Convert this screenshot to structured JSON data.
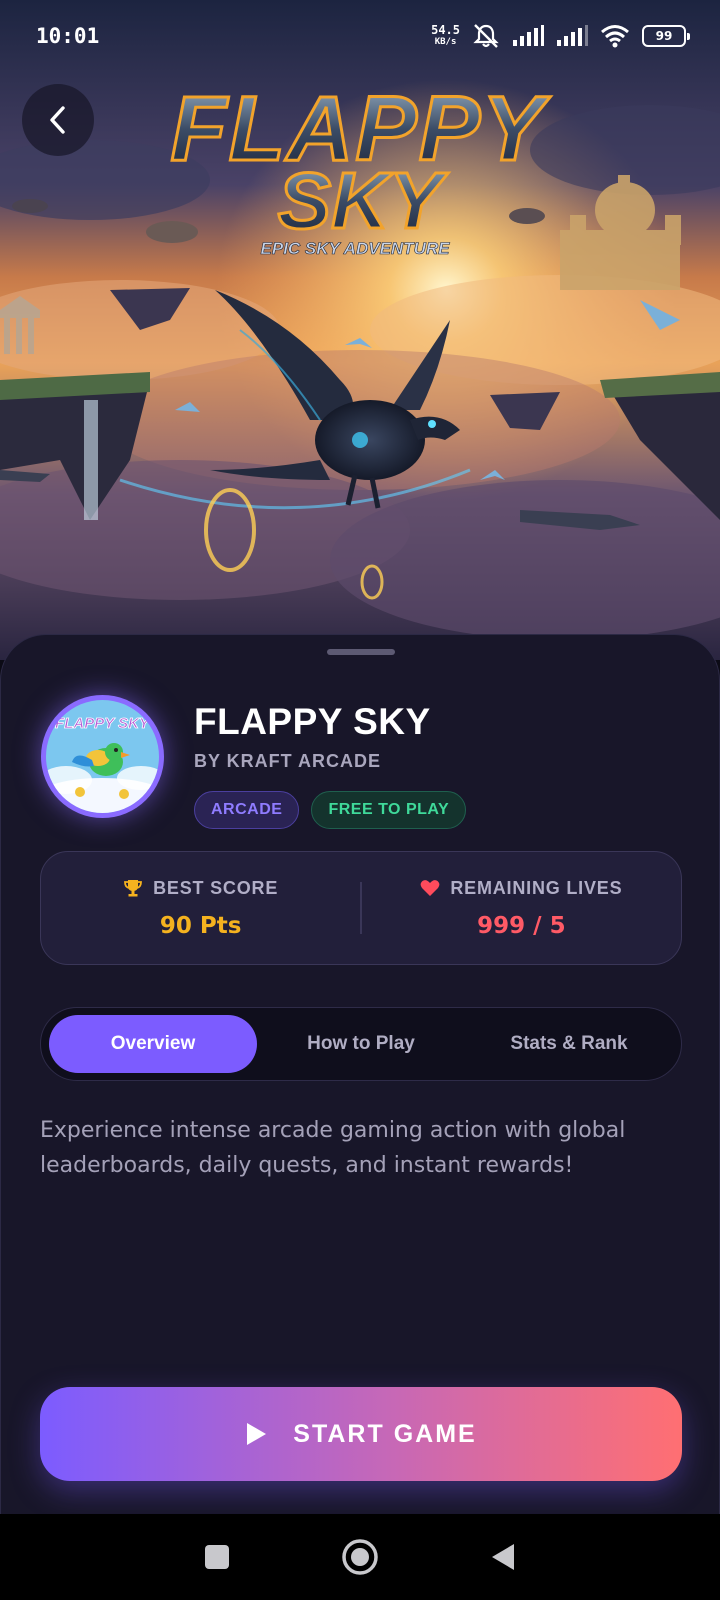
{
  "status_bar": {
    "time": "10:01",
    "net_speed_value": "54.5",
    "net_speed_unit": "KB/s",
    "battery": "99",
    "icons": [
      "mute-icon",
      "signal-icon",
      "signal-icon",
      "wifi-icon",
      "battery-icon"
    ]
  },
  "hero": {
    "logo_line1": "FLAPPY",
    "logo_line2": "SKY",
    "logo_tagline": "EPIC SKY ADVENTURE",
    "back_icon": "chevron-left-icon"
  },
  "game": {
    "icon_text": "FLAPPY SKY",
    "title": "FLAPPY SKY",
    "publisher": "BY KRAFT ARCADE",
    "tags": [
      "ARCADE",
      "FREE TO PLAY"
    ]
  },
  "stats": {
    "best_score_label": "BEST SCORE",
    "best_score_value": "90 Pts",
    "best_score_icon": "trophy-icon",
    "lives_label": "REMAINING LIVES",
    "lives_value": "999 / 5",
    "lives_icon": "heart-icon"
  },
  "tabs": [
    {
      "label": "Overview",
      "active": true
    },
    {
      "label": "How to Play",
      "active": false
    },
    {
      "label": "Stats & Rank",
      "active": false
    }
  ],
  "description": "Experience intense arcade gaming action with global leaderboards, daily quests, and instant rewards!",
  "cta": {
    "label": "START GAME",
    "icon": "play-icon"
  },
  "colors": {
    "accent": "#7c5cff",
    "score": "#f5b21f",
    "lives": "#ff5a66",
    "cta_gradient_start": "#7c5cff",
    "cta_gradient_end": "#ff6f72",
    "sheet_bg": "#181629"
  },
  "nav_bar": [
    "square-icon",
    "home-circle-icon",
    "back-triangle-icon"
  ]
}
